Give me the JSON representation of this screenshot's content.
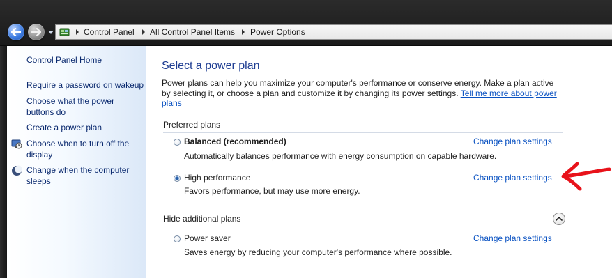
{
  "breadcrumb": [
    "Control Panel",
    "All Control Panel Items",
    "Power Options"
  ],
  "nav": {
    "links": [
      "Control Panel Home",
      "Require a password on wakeup",
      "Choose what the power buttons do",
      "Create a power plan",
      "Choose when to turn off the display",
      "Change when the computer sleeps"
    ]
  },
  "content": {
    "title": "Select a power plan",
    "intro_text": "Power plans can help you maximize your computer's performance or conserve energy. Make a plan active by selecting it, or choose a plan and customize it by changing its power settings. ",
    "intro_link": "Tell me more about power plans",
    "preferred_label": "Preferred plans",
    "hide_label": "Hide additional plans",
    "plans": [
      {
        "name": "Balanced (recommended)",
        "desc": "Automatically balances performance with energy consumption on capable hardware.",
        "link": "Change plan settings",
        "selected": false
      },
      {
        "name": "High performance",
        "desc": "Favors performance, but may use more energy.",
        "link": "Change plan settings",
        "selected": true
      },
      {
        "name": "Power saver",
        "desc": "Saves energy by reducing your computer's performance where possible.",
        "link": "Change plan settings",
        "selected": false
      }
    ]
  },
  "icons": {
    "back": "back-arrow-icon",
    "forward": "forward-arrow-icon",
    "address": "control-panel-icon",
    "display": "monitor-clock-icon",
    "sleep": "moon-icon",
    "expand": "chevron-up-icon"
  },
  "colors": {
    "link": "#0a52c2",
    "nav_link": "#0b2a6f",
    "title": "#1e3d92",
    "annotation_arrow": "#e8121a"
  }
}
